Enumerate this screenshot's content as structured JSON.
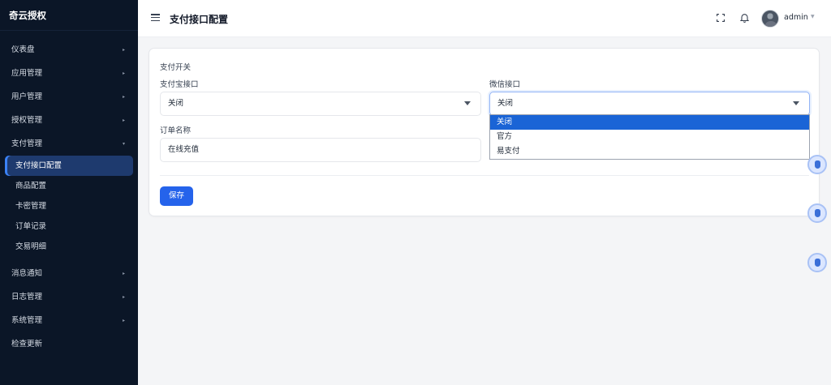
{
  "app": {
    "brand": "奇云授权"
  },
  "header": {
    "title": "支付接口配置",
    "username": "admin"
  },
  "sidebar": {
    "items": [
      {
        "label": "仪表盘"
      },
      {
        "label": "应用管理"
      },
      {
        "label": "用户管理"
      },
      {
        "label": "授权管理"
      },
      {
        "label": "支付管理"
      }
    ],
    "submenu": [
      {
        "label": "支付接口配置"
      },
      {
        "label": "商品配置"
      },
      {
        "label": "卡密管理"
      },
      {
        "label": "订单记录"
      },
      {
        "label": "交易明细"
      }
    ],
    "items_after": [
      {
        "label": "消息通知"
      },
      {
        "label": "日志管理"
      },
      {
        "label": "系统管理"
      },
      {
        "label": "检查更新"
      }
    ]
  },
  "form": {
    "section_title": "支付开关",
    "alipay_label": "支付宝接口",
    "alipay_value": "关闭",
    "wechat_label": "微信接口",
    "wechat_value": "关闭",
    "order_name_label": "订单名称",
    "order_name_value": "在线充值",
    "save_label": "保存"
  },
  "wechat_dropdown": {
    "options": [
      "关闭",
      "官方",
      "易支付"
    ],
    "selected": "关闭"
  },
  "colors": {
    "sidebar_bg": "#0b1627",
    "active_item_bg": "#1e3a6e",
    "primary": "#2563eb",
    "selected_option": "#1a64d6"
  }
}
